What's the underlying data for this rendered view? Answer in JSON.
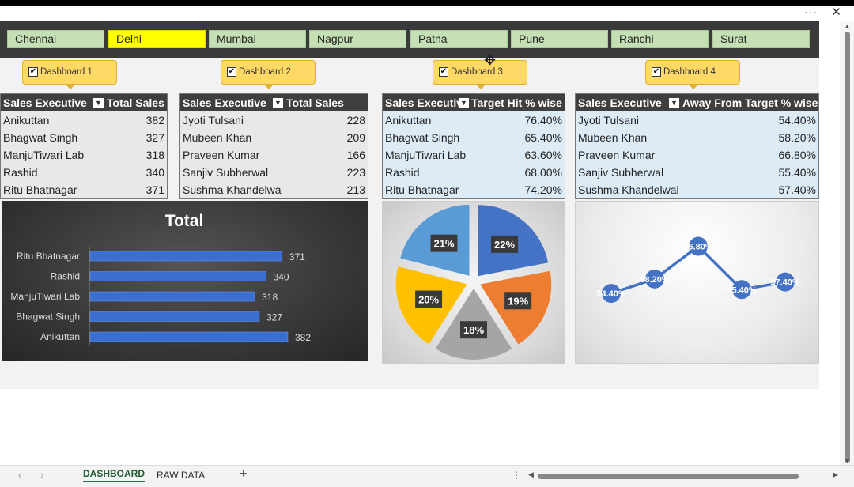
{
  "window": {
    "more_label": "···",
    "close_label": "✕"
  },
  "slicer": {
    "items": [
      {
        "label": "Chennai",
        "selected": false
      },
      {
        "label": "Delhi",
        "selected": true
      },
      {
        "label": "Mumbai",
        "selected": false
      },
      {
        "label": "Nagpur",
        "selected": false
      },
      {
        "label": "Patna",
        "selected": false
      },
      {
        "label": "Pune",
        "selected": false
      },
      {
        "label": "Ranchi",
        "selected": false
      },
      {
        "label": "Surat",
        "selected": false
      }
    ]
  },
  "dashboards": [
    {
      "label": "Dashboard 1",
      "checked": true
    },
    {
      "label": "Dashboard 2",
      "checked": true
    },
    {
      "label": "Dashboard 3",
      "checked": true
    },
    {
      "label": "Dashboard 4",
      "checked": true
    }
  ],
  "tables": [
    {
      "col1": "Sales Executive",
      "col2": "Total Sales",
      "rows": [
        {
          "name": "Anikuttan",
          "value": "382"
        },
        {
          "name": "Bhagwat Singh",
          "value": "327"
        },
        {
          "name": "ManjuTiwari Lab",
          "value": "318"
        },
        {
          "name": "Rashid",
          "value": "340"
        },
        {
          "name": "Ritu Bhatnagar",
          "value": "371"
        }
      ]
    },
    {
      "col1": "Sales Executive",
      "col2": "Total Sales",
      "rows": [
        {
          "name": "Jyoti Tulsani",
          "value": "228"
        },
        {
          "name": "Mubeen Khan",
          "value": "209"
        },
        {
          "name": "Praveen Kumar",
          "value": "166"
        },
        {
          "name": "Sanjiv Subherwal",
          "value": "223"
        },
        {
          "name": "Sushma Khandelwa",
          "value": "213"
        }
      ]
    },
    {
      "col1": "Sales Executiv",
      "col2": "Target Hit % wise",
      "rows": [
        {
          "name": "Anikuttan",
          "value": "76.40%"
        },
        {
          "name": "Bhagwat Singh",
          "value": "65.40%"
        },
        {
          "name": "ManjuTiwari Lab",
          "value": "63.60%"
        },
        {
          "name": "Rashid",
          "value": "68.00%"
        },
        {
          "name": "Ritu Bhatnagar",
          "value": "74.20%"
        }
      ]
    },
    {
      "col1": "Sales Executive",
      "col2": "Away From Target % wise",
      "rows": [
        {
          "name": "Jyoti Tulsani",
          "value": "54.40%"
        },
        {
          "name": "Mubeen Khan",
          "value": "58.20%"
        },
        {
          "name": "Praveen Kumar",
          "value": "66.80%"
        },
        {
          "name": "Sanjiv Subherwal",
          "value": "55.40%"
        },
        {
          "name": "Sushma Khandelwal",
          "value": "57.40%"
        }
      ]
    }
  ],
  "chart_data": [
    {
      "type": "bar",
      "title": "Total",
      "categories": [
        "Ritu Bhatnagar",
        "Rashid",
        "ManjuTiwari Lab",
        "Bhagwat Singh",
        "Anikuttan"
      ],
      "values": [
        371,
        340,
        318,
        327,
        382
      ],
      "orientation": "horizontal",
      "color": "#3a6fd1"
    },
    {
      "type": "pie",
      "labels": [
        "22%",
        "19%",
        "18%",
        "20%",
        "21%"
      ],
      "values": [
        22,
        19,
        18,
        20,
        21
      ],
      "colors": [
        "#4472c4",
        "#ed7d31",
        "#a5a5a5",
        "#ffc000",
        "#5b9bd5"
      ]
    },
    {
      "type": "line",
      "labels": [
        "54.40%",
        "58.20%",
        "66.80%",
        "55.40%",
        "57.40%"
      ],
      "values": [
        54.4,
        58.2,
        66.8,
        55.4,
        57.4
      ],
      "color": "#4472c4"
    }
  ],
  "tabs": {
    "active": "DASHBOARD",
    "other": "RAW DATA",
    "add_label": "+",
    "prev_label": "‹",
    "next_label": "›"
  },
  "colors": {
    "accent": "#217346",
    "slicer_selected": "#ffff00",
    "slicer_item": "#c5e0b4"
  }
}
